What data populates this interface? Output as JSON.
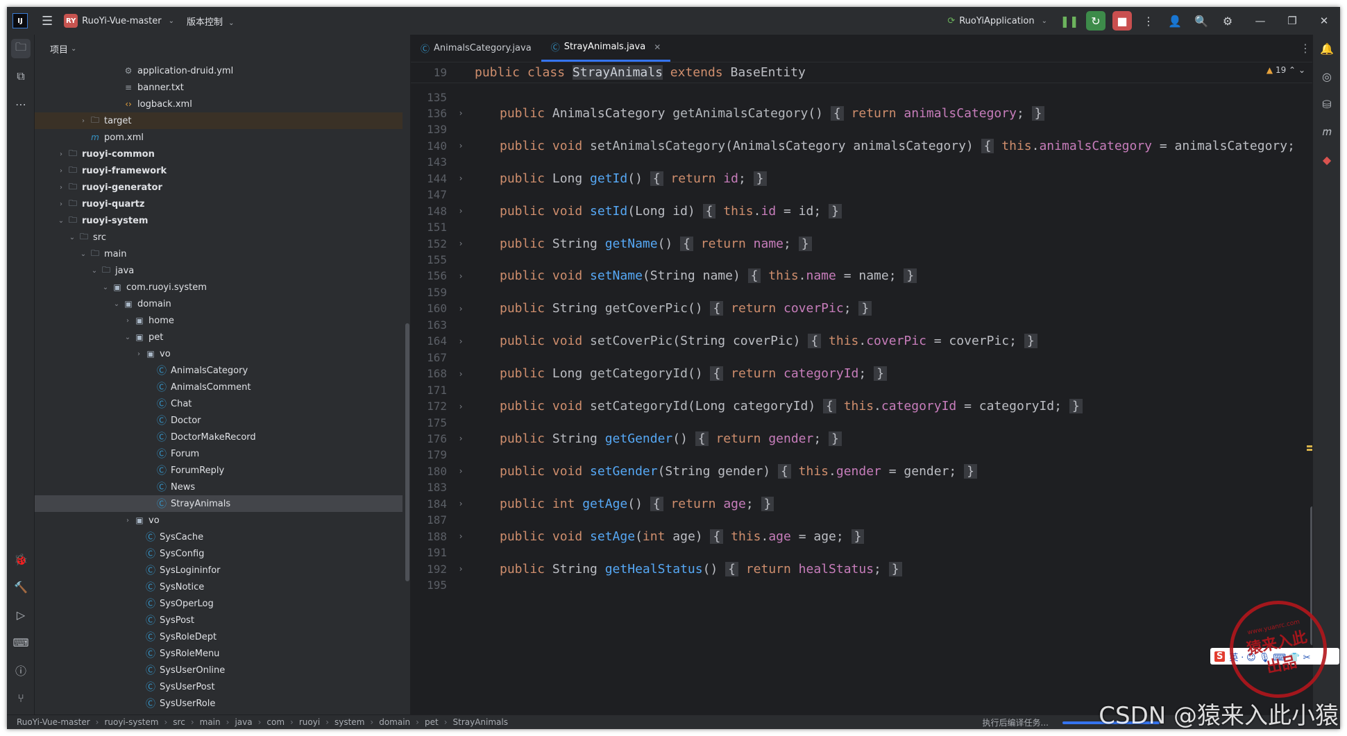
{
  "titlebar": {
    "logo": "IJ",
    "project_badge": "RY",
    "project_name": "RuoYi-Vue-master",
    "vcs_label": "版本控制",
    "run_config": "RuoYiApplication"
  },
  "project_panel": {
    "title": "项目",
    "tree": [
      {
        "label": "application-druid.yml",
        "icon": "yaml-file-icon",
        "indent": 6,
        "arrow": ""
      },
      {
        "label": "banner.txt",
        "icon": "text-file-icon",
        "indent": 6,
        "arrow": ""
      },
      {
        "label": "logback.xml",
        "icon": "xml-file-icon",
        "indent": 6,
        "arrow": ""
      },
      {
        "label": "target",
        "icon": "folder-icon",
        "indent": 3,
        "arrow": "›",
        "state": "excluded"
      },
      {
        "label": "pom.xml",
        "icon": "maven-icon",
        "indent": 3,
        "arrow": ""
      },
      {
        "label": "ruoyi-common",
        "icon": "module-folder-icon",
        "indent": 1,
        "arrow": "›",
        "bold": true
      },
      {
        "label": "ruoyi-framework",
        "icon": "module-folder-icon",
        "indent": 1,
        "arrow": "›",
        "bold": true
      },
      {
        "label": "ruoyi-generator",
        "icon": "module-folder-icon",
        "indent": 1,
        "arrow": "›",
        "bold": true
      },
      {
        "label": "ruoyi-quartz",
        "icon": "module-folder-icon",
        "indent": 1,
        "arrow": "›",
        "bold": true
      },
      {
        "label": "ruoyi-system",
        "icon": "module-folder-icon",
        "indent": 1,
        "arrow": "⌄",
        "bold": true
      },
      {
        "label": "src",
        "icon": "folder-icon",
        "indent": 2,
        "arrow": "⌄"
      },
      {
        "label": "main",
        "icon": "folder-icon",
        "indent": 3,
        "arrow": "⌄"
      },
      {
        "label": "java",
        "icon": "source-folder-icon",
        "indent": 4,
        "arrow": "⌄"
      },
      {
        "label": "com.ruoyi.system",
        "icon": "package-icon",
        "indent": 5,
        "arrow": "⌄"
      },
      {
        "label": "domain",
        "icon": "package-icon",
        "indent": 6,
        "arrow": "⌄"
      },
      {
        "label": "home",
        "icon": "package-icon",
        "indent": 7,
        "arrow": "›"
      },
      {
        "label": "pet",
        "icon": "package-icon",
        "indent": 7,
        "arrow": "⌄"
      },
      {
        "label": "vo",
        "icon": "package-icon",
        "indent": 8,
        "arrow": "›"
      },
      {
        "label": "AnimalsCategory",
        "icon": "class-icon",
        "indent": 9,
        "arrow": ""
      },
      {
        "label": "AnimalsComment",
        "icon": "class-icon",
        "indent": 9,
        "arrow": ""
      },
      {
        "label": "Chat",
        "icon": "class-icon",
        "indent": 9,
        "arrow": ""
      },
      {
        "label": "Doctor",
        "icon": "class-icon",
        "indent": 9,
        "arrow": ""
      },
      {
        "label": "DoctorMakeRecord",
        "icon": "class-icon",
        "indent": 9,
        "arrow": ""
      },
      {
        "label": "Forum",
        "icon": "class-icon",
        "indent": 9,
        "arrow": ""
      },
      {
        "label": "ForumReply",
        "icon": "class-icon",
        "indent": 9,
        "arrow": ""
      },
      {
        "label": "News",
        "icon": "class-icon",
        "indent": 9,
        "arrow": ""
      },
      {
        "label": "StrayAnimals",
        "icon": "class-icon",
        "indent": 9,
        "arrow": "",
        "state": "selected"
      },
      {
        "label": "vo",
        "icon": "package-icon",
        "indent": 7,
        "arrow": "›"
      },
      {
        "label": "SysCache",
        "icon": "class-icon",
        "indent": 8,
        "arrow": ""
      },
      {
        "label": "SysConfig",
        "icon": "class-icon",
        "indent": 8,
        "arrow": ""
      },
      {
        "label": "SysLogininfor",
        "icon": "class-icon",
        "indent": 8,
        "arrow": ""
      },
      {
        "label": "SysNotice",
        "icon": "class-icon",
        "indent": 8,
        "arrow": ""
      },
      {
        "label": "SysOperLog",
        "icon": "class-icon",
        "indent": 8,
        "arrow": ""
      },
      {
        "label": "SysPost",
        "icon": "class-icon",
        "indent": 8,
        "arrow": ""
      },
      {
        "label": "SysRoleDept",
        "icon": "class-icon",
        "indent": 8,
        "arrow": ""
      },
      {
        "label": "SysRoleMenu",
        "icon": "class-icon",
        "indent": 8,
        "arrow": ""
      },
      {
        "label": "SysUserOnline",
        "icon": "class-icon",
        "indent": 8,
        "arrow": ""
      },
      {
        "label": "SysUserPost",
        "icon": "class-icon",
        "indent": 8,
        "arrow": ""
      },
      {
        "label": "SysUserRole",
        "icon": "class-icon",
        "indent": 8,
        "arrow": ""
      }
    ]
  },
  "editor": {
    "tabs": [
      {
        "label": "AnimalsCategory.java",
        "active": false
      },
      {
        "label": "StrayAnimals.java",
        "active": true
      }
    ],
    "warnings_count": "19",
    "sticky_line_no": "19",
    "sticky_text": [
      {
        "t": "public class ",
        "c": "kw"
      },
      {
        "t": "StrayAnimals",
        "c": "hl"
      },
      {
        "t": " extends ",
        "c": "kw"
      },
      {
        "t": "BaseEntity",
        "c": "pl"
      }
    ],
    "lines": [
      {
        "no": "135",
        "fold": false,
        "parts": []
      },
      {
        "no": "136",
        "fold": true,
        "parts": [
          {
            "t": "public ",
            "c": "kw"
          },
          {
            "t": "AnimalsCategory ",
            "c": "pl"
          },
          {
            "t": "getAnimalsCategory",
            "c": "fnu"
          },
          {
            "t": "() ",
            "c": "pl"
          },
          {
            "t": "{",
            "c": "br"
          },
          {
            "t": " return ",
            "c": "kw"
          },
          {
            "t": "animalsCategory",
            "c": "fd"
          },
          {
            "t": "; ",
            "c": "pl"
          },
          {
            "t": "}",
            "c": "br"
          }
        ]
      },
      {
        "no": "139",
        "fold": false,
        "parts": []
      },
      {
        "no": "140",
        "fold": true,
        "parts": [
          {
            "t": "public void ",
            "c": "kw"
          },
          {
            "t": "setAnimalsCategory",
            "c": "fnu"
          },
          {
            "t": "(AnimalsCategory animalsCategory) ",
            "c": "pl"
          },
          {
            "t": "{",
            "c": "br"
          },
          {
            "t": " this",
            "c": "kw"
          },
          {
            "t": ".",
            "c": "pl"
          },
          {
            "t": "animalsCategory",
            "c": "fd"
          },
          {
            "t": " = animalsCategory;",
            "c": "pl"
          }
        ]
      },
      {
        "no": "143",
        "fold": false,
        "parts": []
      },
      {
        "no": "144",
        "fold": true,
        "parts": [
          {
            "t": "public ",
            "c": "kw"
          },
          {
            "t": "Long ",
            "c": "pl"
          },
          {
            "t": "getId",
            "c": "fn"
          },
          {
            "t": "() ",
            "c": "pl"
          },
          {
            "t": "{",
            "c": "br"
          },
          {
            "t": " return ",
            "c": "kw"
          },
          {
            "t": "id",
            "c": "fd"
          },
          {
            "t": "; ",
            "c": "pl"
          },
          {
            "t": "}",
            "c": "br"
          }
        ]
      },
      {
        "no": "147",
        "fold": false,
        "parts": []
      },
      {
        "no": "148",
        "fold": true,
        "parts": [
          {
            "t": "public void ",
            "c": "kw"
          },
          {
            "t": "setId",
            "c": "fn"
          },
          {
            "t": "(Long id) ",
            "c": "pl"
          },
          {
            "t": "{",
            "c": "br"
          },
          {
            "t": " this",
            "c": "kw"
          },
          {
            "t": ".",
            "c": "pl"
          },
          {
            "t": "id",
            "c": "fd"
          },
          {
            "t": " = id; ",
            "c": "pl"
          },
          {
            "t": "}",
            "c": "br"
          }
        ]
      },
      {
        "no": "151",
        "fold": false,
        "parts": []
      },
      {
        "no": "152",
        "fold": true,
        "parts": [
          {
            "t": "public ",
            "c": "kw"
          },
          {
            "t": "String ",
            "c": "pl"
          },
          {
            "t": "getName",
            "c": "fn"
          },
          {
            "t": "() ",
            "c": "pl"
          },
          {
            "t": "{",
            "c": "br"
          },
          {
            "t": " return ",
            "c": "kw"
          },
          {
            "t": "name",
            "c": "fd"
          },
          {
            "t": "; ",
            "c": "pl"
          },
          {
            "t": "}",
            "c": "br"
          }
        ]
      },
      {
        "no": "155",
        "fold": false,
        "parts": []
      },
      {
        "no": "156",
        "fold": true,
        "parts": [
          {
            "t": "public void ",
            "c": "kw"
          },
          {
            "t": "setName",
            "c": "fn"
          },
          {
            "t": "(String name) ",
            "c": "pl"
          },
          {
            "t": "{",
            "c": "br"
          },
          {
            "t": " this",
            "c": "kw"
          },
          {
            "t": ".",
            "c": "pl"
          },
          {
            "t": "name",
            "c": "fd"
          },
          {
            "t": " = name; ",
            "c": "pl"
          },
          {
            "t": "}",
            "c": "br"
          }
        ]
      },
      {
        "no": "159",
        "fold": false,
        "parts": []
      },
      {
        "no": "160",
        "fold": true,
        "parts": [
          {
            "t": "public ",
            "c": "kw"
          },
          {
            "t": "String ",
            "c": "pl"
          },
          {
            "t": "getCoverPic",
            "c": "fnu"
          },
          {
            "t": "() ",
            "c": "pl"
          },
          {
            "t": "{",
            "c": "br"
          },
          {
            "t": " return ",
            "c": "kw"
          },
          {
            "t": "coverPic",
            "c": "fd"
          },
          {
            "t": "; ",
            "c": "pl"
          },
          {
            "t": "}",
            "c": "br"
          }
        ]
      },
      {
        "no": "163",
        "fold": false,
        "parts": []
      },
      {
        "no": "164",
        "fold": true,
        "parts": [
          {
            "t": "public void ",
            "c": "kw"
          },
          {
            "t": "setCoverPic",
            "c": "fnu"
          },
          {
            "t": "(String coverPic) ",
            "c": "pl"
          },
          {
            "t": "{",
            "c": "br"
          },
          {
            "t": " this",
            "c": "kw"
          },
          {
            "t": ".",
            "c": "pl"
          },
          {
            "t": "coverPic",
            "c": "fd"
          },
          {
            "t": " = coverPic; ",
            "c": "pl"
          },
          {
            "t": "}",
            "c": "br"
          }
        ]
      },
      {
        "no": "167",
        "fold": false,
        "parts": []
      },
      {
        "no": "168",
        "fold": true,
        "parts": [
          {
            "t": "public ",
            "c": "kw"
          },
          {
            "t": "Long ",
            "c": "pl"
          },
          {
            "t": "getCategoryId",
            "c": "fnu"
          },
          {
            "t": "() ",
            "c": "pl"
          },
          {
            "t": "{",
            "c": "br"
          },
          {
            "t": " return ",
            "c": "kw"
          },
          {
            "t": "categoryId",
            "c": "fd"
          },
          {
            "t": "; ",
            "c": "pl"
          },
          {
            "t": "}",
            "c": "br"
          }
        ]
      },
      {
        "no": "171",
        "fold": false,
        "parts": []
      },
      {
        "no": "172",
        "fold": true,
        "parts": [
          {
            "t": "public void ",
            "c": "kw"
          },
          {
            "t": "setCategoryId",
            "c": "fnu"
          },
          {
            "t": "(Long categoryId) ",
            "c": "pl"
          },
          {
            "t": "{",
            "c": "br"
          },
          {
            "t": " this",
            "c": "kw"
          },
          {
            "t": ".",
            "c": "pl"
          },
          {
            "t": "categoryId",
            "c": "fd"
          },
          {
            "t": " = categoryId; ",
            "c": "pl"
          },
          {
            "t": "}",
            "c": "br"
          }
        ]
      },
      {
        "no": "175",
        "fold": false,
        "parts": []
      },
      {
        "no": "176",
        "fold": true,
        "parts": [
          {
            "t": "public ",
            "c": "kw"
          },
          {
            "t": "String ",
            "c": "pl"
          },
          {
            "t": "getGender",
            "c": "fn"
          },
          {
            "t": "() ",
            "c": "pl"
          },
          {
            "t": "{",
            "c": "br"
          },
          {
            "t": " return ",
            "c": "kw"
          },
          {
            "t": "gender",
            "c": "fd"
          },
          {
            "t": "; ",
            "c": "pl"
          },
          {
            "t": "}",
            "c": "br"
          }
        ]
      },
      {
        "no": "179",
        "fold": false,
        "parts": []
      },
      {
        "no": "180",
        "fold": true,
        "parts": [
          {
            "t": "public void ",
            "c": "kw"
          },
          {
            "t": "setGender",
            "c": "fn"
          },
          {
            "t": "(String gender) ",
            "c": "pl"
          },
          {
            "t": "{",
            "c": "br"
          },
          {
            "t": " this",
            "c": "kw"
          },
          {
            "t": ".",
            "c": "pl"
          },
          {
            "t": "gender",
            "c": "fd"
          },
          {
            "t": " = gender; ",
            "c": "pl"
          },
          {
            "t": "}",
            "c": "br"
          }
        ]
      },
      {
        "no": "183",
        "fold": false,
        "parts": []
      },
      {
        "no": "184",
        "fold": true,
        "parts": [
          {
            "t": "public int ",
            "c": "kw"
          },
          {
            "t": "getAge",
            "c": "fn"
          },
          {
            "t": "() ",
            "c": "pl"
          },
          {
            "t": "{",
            "c": "br"
          },
          {
            "t": " return ",
            "c": "kw"
          },
          {
            "t": "age",
            "c": "fd"
          },
          {
            "t": "; ",
            "c": "pl"
          },
          {
            "t": "}",
            "c": "br"
          }
        ]
      },
      {
        "no": "187",
        "fold": false,
        "parts": []
      },
      {
        "no": "188",
        "fold": true,
        "parts": [
          {
            "t": "public void ",
            "c": "kw"
          },
          {
            "t": "setAge",
            "c": "fn"
          },
          {
            "t": "(",
            "c": "pl"
          },
          {
            "t": "int ",
            "c": "kw"
          },
          {
            "t": "age) ",
            "c": "pl"
          },
          {
            "t": "{",
            "c": "br"
          },
          {
            "t": " this",
            "c": "kw"
          },
          {
            "t": ".",
            "c": "pl"
          },
          {
            "t": "age",
            "c": "fd"
          },
          {
            "t": " = age; ",
            "c": "pl"
          },
          {
            "t": "}",
            "c": "br"
          }
        ]
      },
      {
        "no": "191",
        "fold": false,
        "parts": []
      },
      {
        "no": "192",
        "fold": true,
        "parts": [
          {
            "t": "public ",
            "c": "kw"
          },
          {
            "t": "String ",
            "c": "pl"
          },
          {
            "t": "getHealStatus",
            "c": "fn"
          },
          {
            "t": "() ",
            "c": "pl"
          },
          {
            "t": "{",
            "c": "br"
          },
          {
            "t": " return ",
            "c": "kw"
          },
          {
            "t": "healStatus",
            "c": "fd"
          },
          {
            "t": "; ",
            "c": "pl"
          },
          {
            "t": "}",
            "c": "br"
          }
        ]
      },
      {
        "no": "195",
        "fold": false,
        "parts": []
      }
    ]
  },
  "statusbar": {
    "breadcrumb": [
      "RuoYi-Vue-master",
      "ruoyi-system",
      "src",
      "main",
      "java",
      "com",
      "ruoyi",
      "system",
      "domain",
      "pet",
      "StrayAnimals"
    ],
    "task": "执行后编译任务..."
  },
  "watermark": {
    "text": "CSDN @猿来入此小猿",
    "stamp_main": "猿来入此",
    "stamp_sub": "出品",
    "stamp_url": "www.yuanrc.com",
    "ime_s": "S",
    "ime_text": "英 ⸱ ☺ 🎙 ⌨ 👕 ✂"
  },
  "colors": {
    "background": "#1e1f22",
    "panel": "#2b2d30",
    "keyword": "#cf8e6d",
    "method": "#56a8f5",
    "field": "#c77dbb",
    "accent": "#3574f0"
  }
}
